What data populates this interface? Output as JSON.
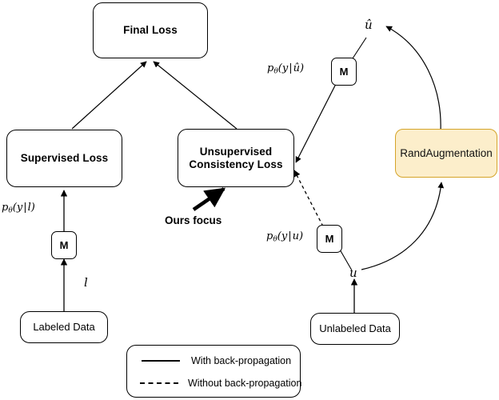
{
  "diagram": {
    "title_text": "",
    "nodes": [
      {
        "id": "final_loss",
        "label": "Final Loss"
      },
      {
        "id": "supervised",
        "label": "Supervised Loss"
      },
      {
        "id": "unsupervised",
        "label": "Unsupervised\nConsistency Loss"
      },
      {
        "id": "rand_aug",
        "label": "RandAugmentation"
      },
      {
        "id": "labeled",
        "label": "Labeled Data"
      },
      {
        "id": "unlabeled",
        "label": "Unlabeled Data"
      },
      {
        "id": "model_left",
        "label": "M"
      },
      {
        "id": "model_top",
        "label": "M"
      },
      {
        "id": "model_bottom",
        "label": "M"
      }
    ],
    "math_labels": {
      "labeled_prob": {
        "p": "p",
        "theta": "θ",
        "open": "(",
        "y": "y",
        "bar": "|",
        "arg": "l",
        "close": ")"
      },
      "aug_prob": {
        "p": "p",
        "theta": "θ",
        "open": "(",
        "y": "y",
        "bar": "|",
        "arg": "û",
        "close": ")"
      },
      "unaug_prob": {
        "p": "p",
        "theta": "θ",
        "open": "(",
        "y": "y",
        "bar": "|",
        "arg": "u",
        "close": ")"
      }
    },
    "variable_labels": {
      "labeled_var": "l",
      "unlabeled_var": "u",
      "augmented_var": "û"
    },
    "annotations": {
      "ours_focus": "Ours focus"
    },
    "legend": {
      "rows": [
        {
          "style": "solid",
          "label": "With back-propagation"
        },
        {
          "style": "dashed",
          "label": "Without back-propagation"
        }
      ]
    },
    "colors": {
      "edge": "#000000",
      "node_border": "#000000",
      "node_fill": "#ffffff",
      "augment_fill": "#fceecb",
      "augment_border": "#d5a429",
      "background": "#ffffff"
    }
  }
}
